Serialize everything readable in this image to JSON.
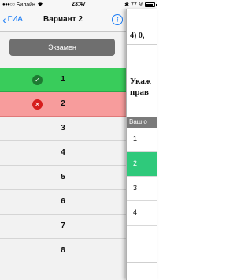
{
  "status": {
    "carrier": "Билайн",
    "signal": "●●●○○",
    "wifi": "wifi-icon",
    "time": "23:47",
    "battery_text": "77 %",
    "bluetooth": "✱"
  },
  "nav": {
    "back_label": "ГИА",
    "title": "Вариант 2",
    "info_label": "i"
  },
  "left": {
    "exam_button": "Экзамен",
    "questions": [
      {
        "number": "1",
        "status": "correct",
        "mark": "✓"
      },
      {
        "number": "2",
        "status": "wrong",
        "mark": "✕"
      },
      {
        "number": "3",
        "status": "none"
      },
      {
        "number": "4",
        "status": "none"
      },
      {
        "number": "5",
        "status": "none"
      },
      {
        "number": "6",
        "status": "none"
      },
      {
        "number": "7",
        "status": "none"
      },
      {
        "number": "8",
        "status": "none"
      }
    ]
  },
  "right": {
    "prev_answer": "4)  0,",
    "question_line1": "Укаж",
    "question_line2": "прав",
    "answer_header": "Ваш о",
    "options": [
      {
        "label": "1",
        "selected": false
      },
      {
        "label": "2",
        "selected": true
      },
      {
        "label": "3",
        "selected": false
      },
      {
        "label": "4",
        "selected": false
      }
    ]
  }
}
